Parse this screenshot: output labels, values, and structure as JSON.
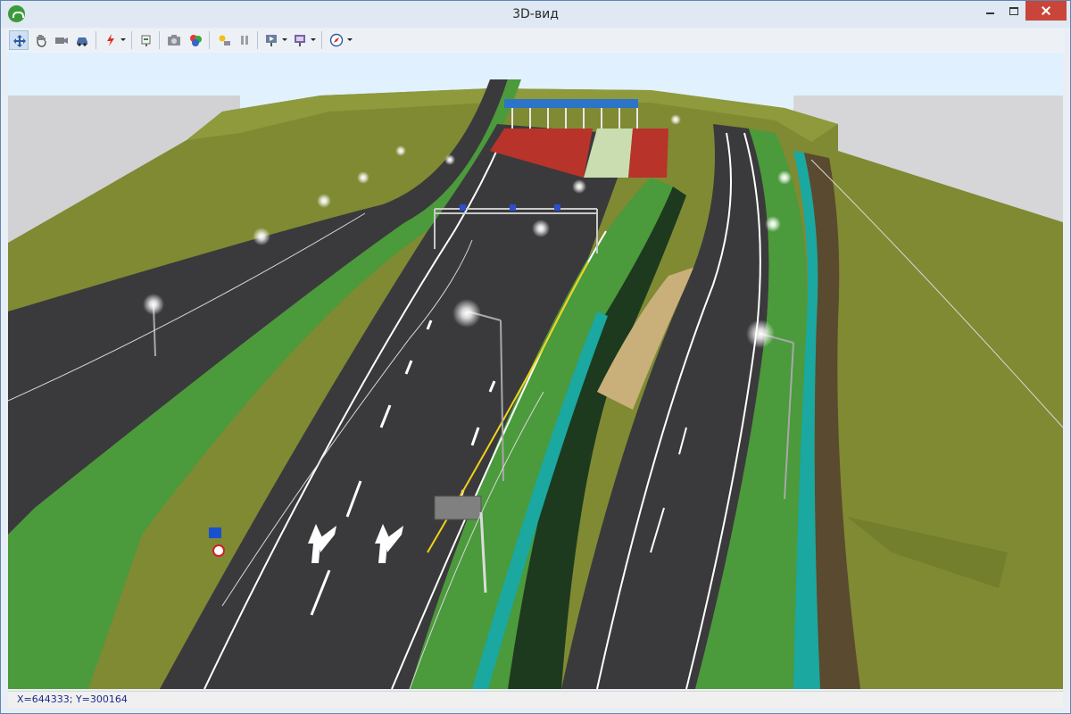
{
  "window": {
    "title": "3D-вид",
    "app_icon": "green-signal-icon",
    "controls": [
      "minimize-icon",
      "maximize-icon",
      "close-icon"
    ]
  },
  "toolbar": {
    "buttons": [
      {
        "icon": "move-arrows-icon",
        "active": true
      },
      {
        "icon": "hand-pan-icon",
        "active": false
      },
      {
        "icon": "camera-view-icon",
        "active": false
      },
      {
        "icon": "car-icon",
        "active": false
      },
      {
        "icon": "lightning-icon",
        "active": false,
        "has_dropdown": true
      },
      {
        "icon": "signpost-icon",
        "active": false
      },
      {
        "icon": "photo-camera-icon",
        "active": false
      },
      {
        "icon": "colors-icon",
        "active": false
      },
      {
        "icon": "light-source-icon",
        "active": false
      },
      {
        "icon": "pause-icon",
        "active": false
      },
      {
        "icon": "presentation-play-icon",
        "active": false,
        "has_dropdown": true
      },
      {
        "icon": "save-screen-icon",
        "active": false,
        "has_dropdown": true
      },
      {
        "icon": "compass-icon",
        "active": false,
        "has_dropdown": true
      }
    ]
  },
  "status": {
    "coordinates": "X=644333; Y=300164"
  },
  "colors": {
    "sky": "#ffffff",
    "grass": "#7f8a33",
    "median": "#4b9a3c",
    "asphalt": "#3a3a3d",
    "toll_canopy": "#2d73c8",
    "toll_lanes": "#b8332a",
    "barrier_edge": "#1aa8a0"
  }
}
